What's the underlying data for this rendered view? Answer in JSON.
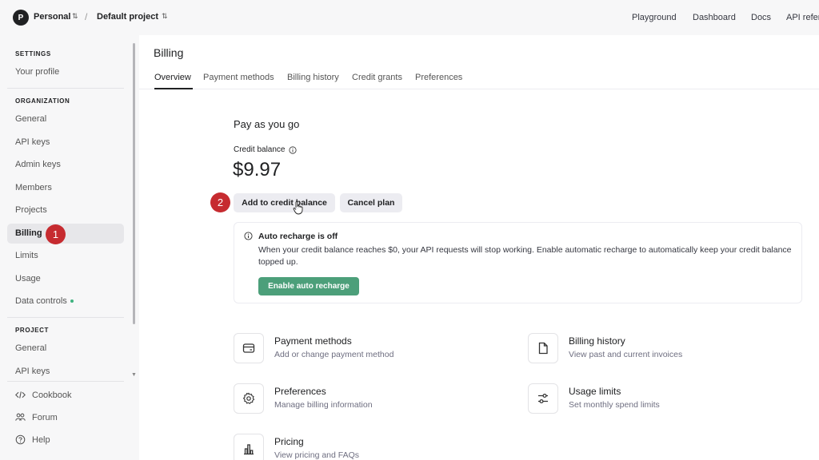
{
  "topbar": {
    "org_initial": "P",
    "org_name": "Personal",
    "separator": "/",
    "project_name": "Default project",
    "nav": [
      "Playground",
      "Dashboard",
      "Docs",
      "API refer"
    ]
  },
  "sidebar": {
    "settings_heading": "SETTINGS",
    "your_profile": "Your profile",
    "organization_heading": "ORGANIZATION",
    "org_items": [
      "General",
      "API keys",
      "Admin keys",
      "Members",
      "Projects",
      "Billing",
      "Limits",
      "Usage",
      "Data controls"
    ],
    "active_item": "Billing",
    "project_heading": "PROJECT",
    "project_items": [
      "General",
      "API keys"
    ],
    "footer": [
      {
        "label": "Cookbook",
        "icon": "code-icon"
      },
      {
        "label": "Forum",
        "icon": "people-icon"
      },
      {
        "label": "Help",
        "icon": "help-icon"
      }
    ]
  },
  "markers": [
    "1",
    "2"
  ],
  "main": {
    "title": "Billing",
    "tabs": [
      "Overview",
      "Payment methods",
      "Billing history",
      "Credit grants",
      "Preferences"
    ],
    "active_tab": "Overview",
    "section_title": "Pay as you go",
    "credit_label": "Credit balance",
    "credit_amount": "$9.97",
    "add_credit_button": "Add to credit balance",
    "cancel_button": "Cancel plan",
    "notice": {
      "title": "Auto recharge is off",
      "text": "When your credit balance reaches $0, your API requests will stop working. Enable automatic recharge to automatically keep your credit balance topped up.",
      "button": "Enable auto recharge"
    },
    "cards": [
      {
        "title": "Payment methods",
        "subtitle": "Add or change payment method",
        "icon": "credit-card-icon"
      },
      {
        "title": "Billing history",
        "subtitle": "View past and current invoices",
        "icon": "document-icon"
      },
      {
        "title": "Preferences",
        "subtitle": "Manage billing information",
        "icon": "gear-icon"
      },
      {
        "title": "Usage limits",
        "subtitle": "Set monthly spend limits",
        "icon": "sliders-icon"
      },
      {
        "title": "Pricing",
        "subtitle": "View pricing and FAQs",
        "icon": "chart-icon"
      }
    ]
  },
  "colors": {
    "accent_green": "#4c9f7a",
    "marker_red": "#c62b30",
    "status_dot": "#3fb27f"
  }
}
